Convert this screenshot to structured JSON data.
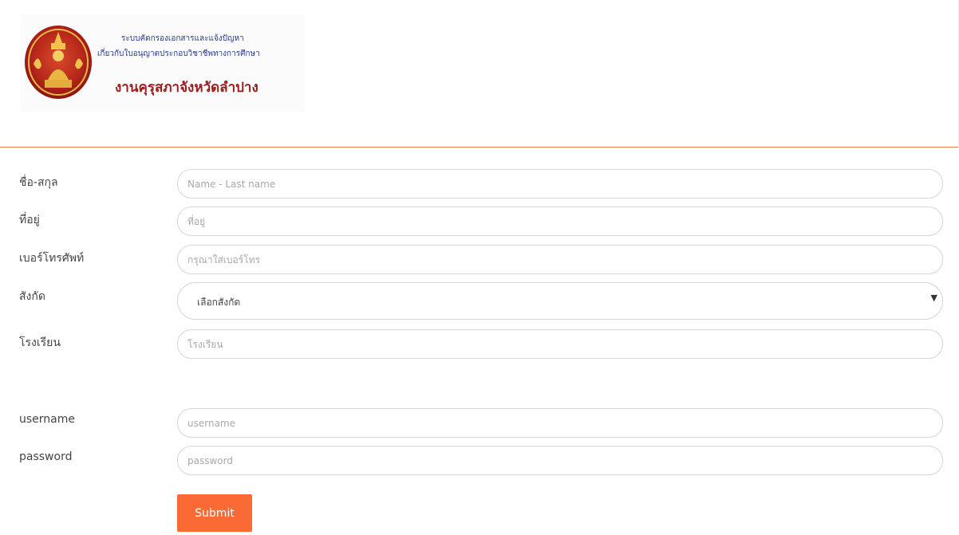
{
  "header": {
    "banner_line1": "ระบบคัดกรองเอกสารและแจ้งปัญหา",
    "banner_line2": "เกี่ยวกับใบอนุญาตประกอบวิชาชีพทางการศึกษา",
    "banner_title": "งานคุรุสภาจังหวัดลำปาง",
    "seal_icon": "royal-emblem-icon"
  },
  "form": {
    "name": {
      "label": "ชื่อ-สกุล",
      "placeholder": "Name - Last name",
      "value": ""
    },
    "address": {
      "label": "ที่อยู่",
      "placeholder": "ที่อยู่",
      "value": ""
    },
    "phone": {
      "label": "เบอร์โทรศัพท์",
      "placeholder": "กรุณาใส่เบอร์โทร",
      "value": ""
    },
    "affiliation": {
      "label": "สังกัด",
      "selected": "เลือกสังกัด"
    },
    "school": {
      "label": "โรงเรียน",
      "placeholder": "โรงเรียน",
      "value": ""
    },
    "username": {
      "label": "username",
      "placeholder": "username",
      "value": ""
    },
    "password": {
      "label": "password",
      "placeholder": "password",
      "value": ""
    },
    "submit_label": "Submit"
  },
  "colors": {
    "accent": "#fa6a35",
    "divider": "#e8804a",
    "banner_title": "#9a1b1b",
    "banner_text": "#2a3a8c"
  }
}
